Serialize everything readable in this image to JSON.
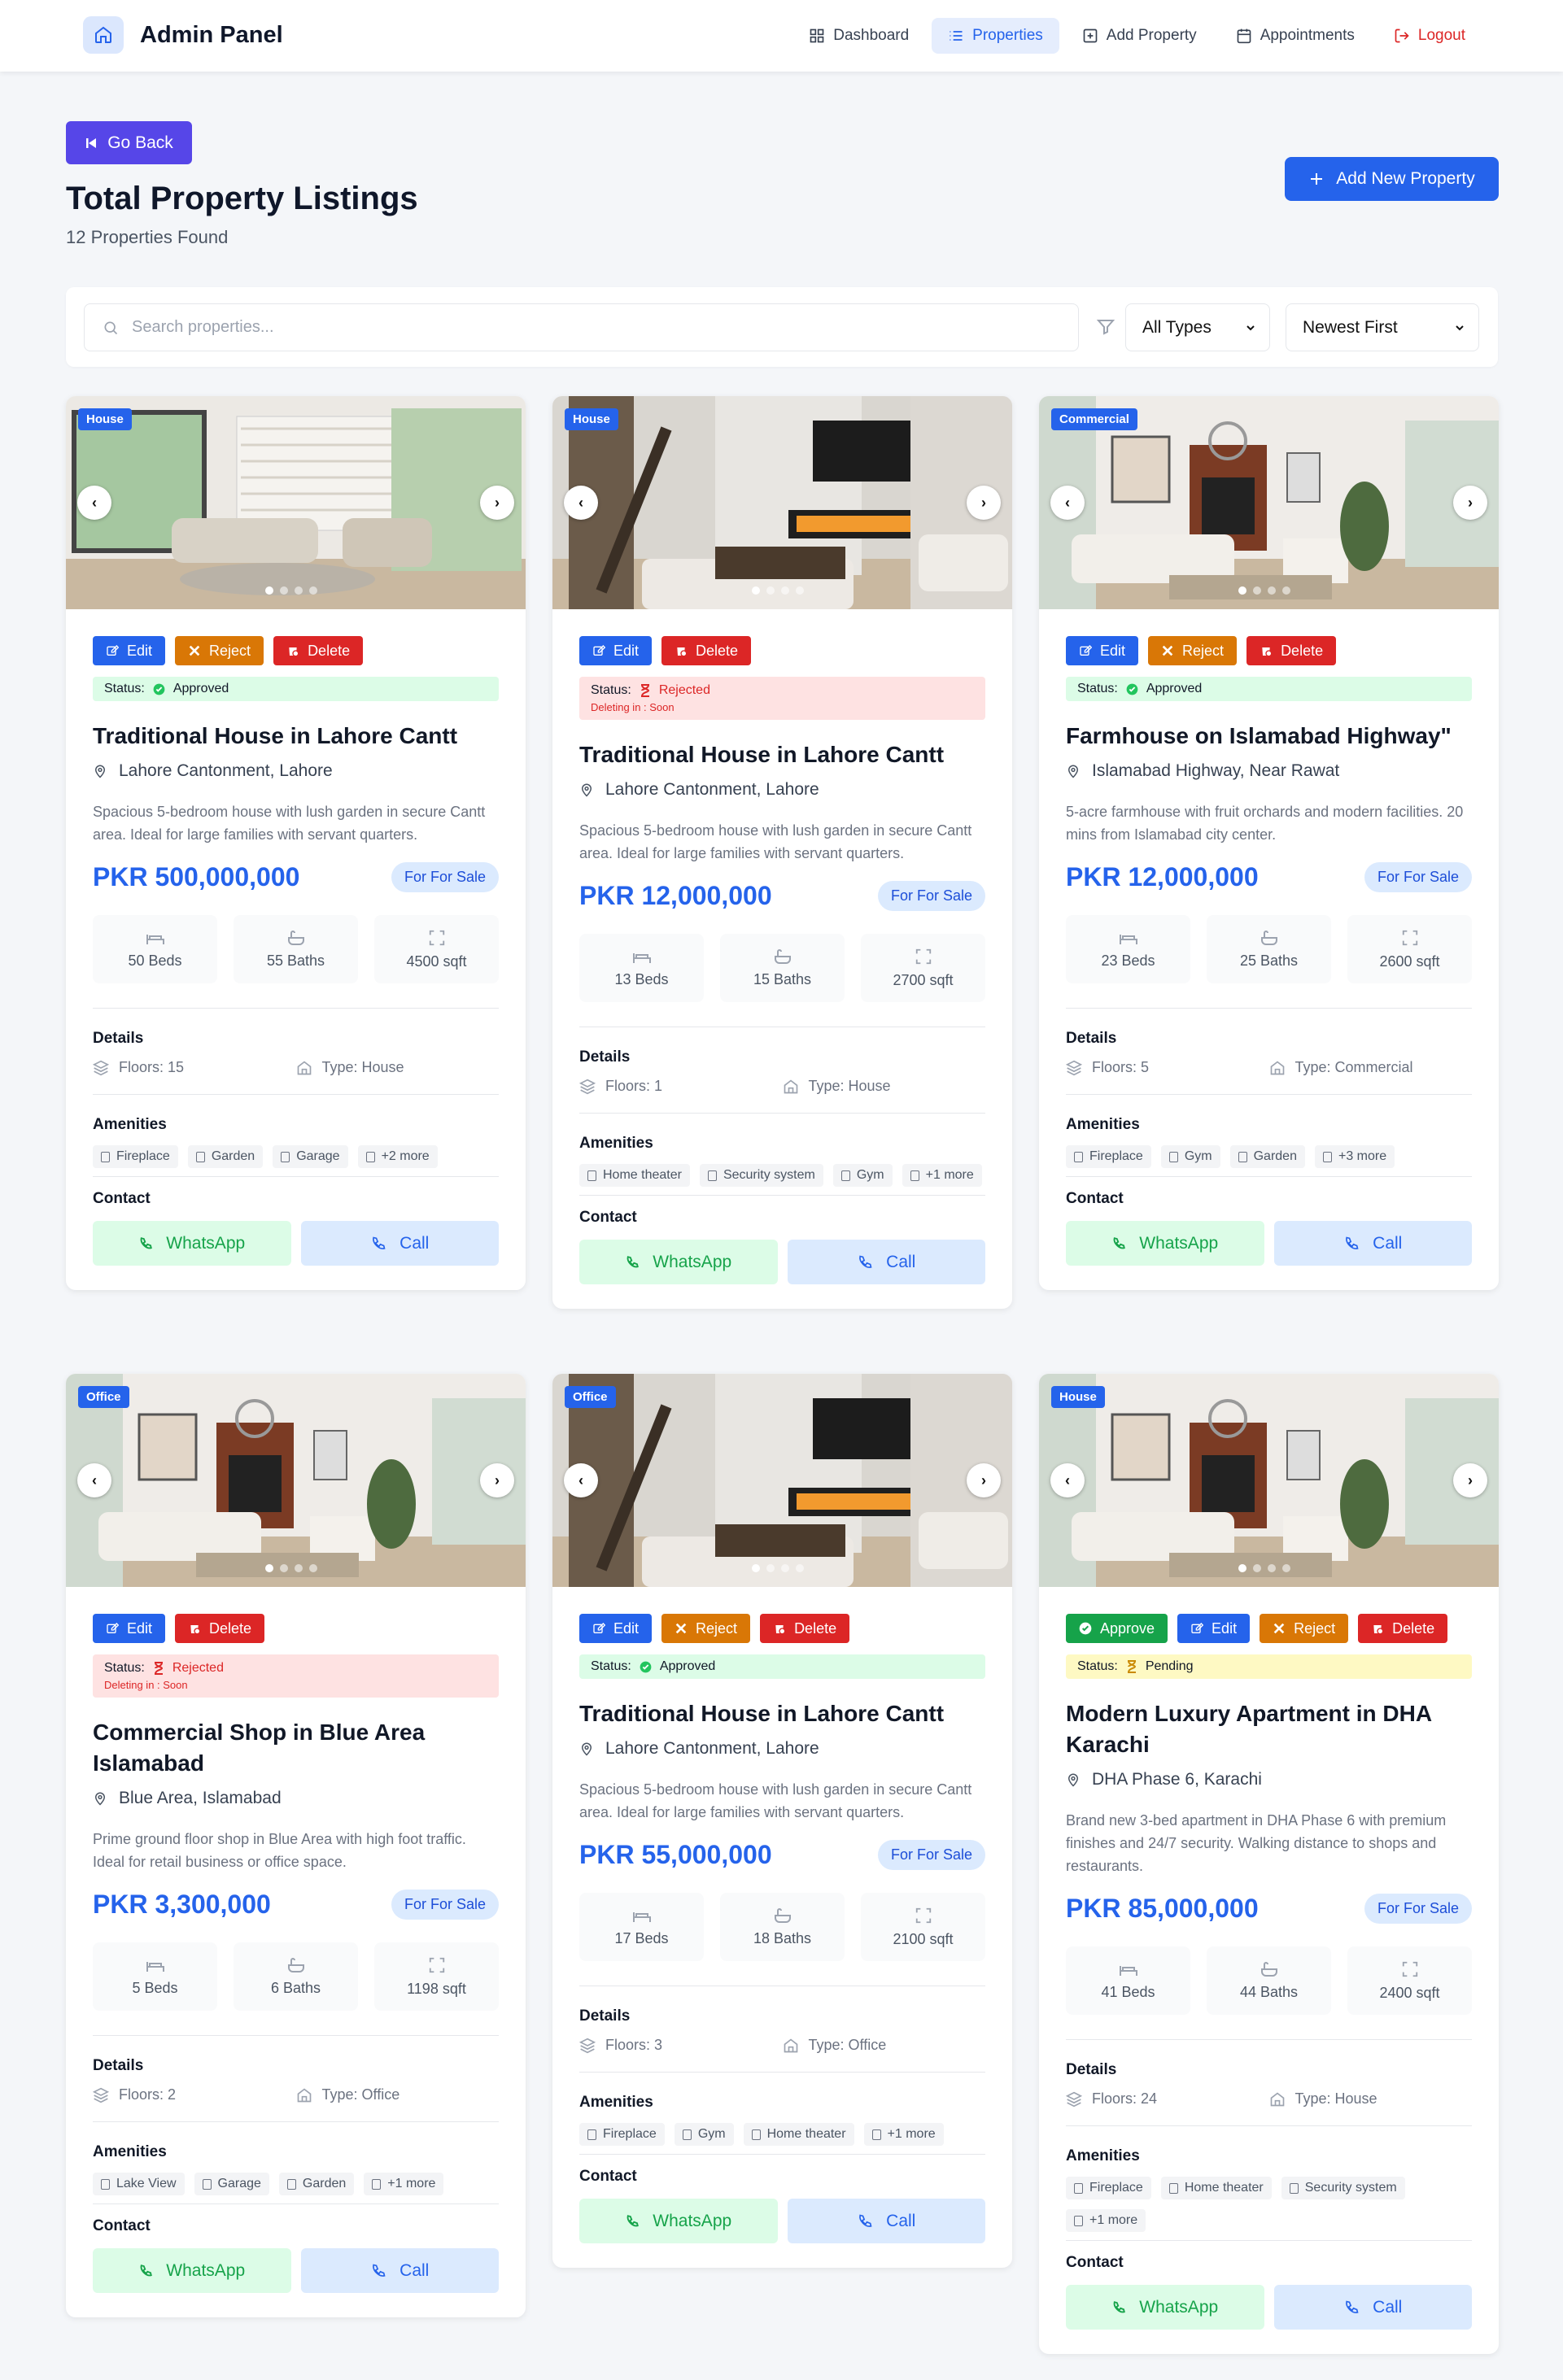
{
  "nav": {
    "brand": "Admin Panel",
    "items": [
      {
        "label": "Dashboard",
        "icon": "grid-icon"
      },
      {
        "label": "Properties",
        "icon": "list-icon"
      },
      {
        "label": "Add Property",
        "icon": "plus-square-icon"
      },
      {
        "label": "Appointments",
        "icon": "calendar-icon"
      }
    ],
    "logout": "Logout"
  },
  "header": {
    "go_back": "Go Back",
    "title": "Total Property Listings",
    "subtitle": "12 Properties Found",
    "add_button": "Add New Property"
  },
  "filters": {
    "search_placeholder": "Search properties...",
    "type_selected": "All Types",
    "sort_selected": "Newest First"
  },
  "labels": {
    "edit": "Edit",
    "reject": "Reject",
    "delete": "Delete",
    "approve": "Approve",
    "status": "Status:",
    "deleting": "Deleting in : Soon",
    "details": "Details",
    "amenities": "Amenities",
    "contact": "Contact",
    "whatsapp": "WhatsApp",
    "call": "Call"
  },
  "colors": {
    "primary": "#2563eb",
    "approved": "#16a34a",
    "rejected": "#dc2626",
    "pending": "#ca8a04",
    "go_back": "#5646e8"
  },
  "properties": [
    {
      "tag": "House",
      "image": "living-room-bright",
      "actions": [
        "edit",
        "reject",
        "delete"
      ],
      "status": "Approved",
      "title": "Traditional House in Lahore Cantt",
      "location": "Lahore Cantonment, Lahore",
      "description": "Spacious 5-bedroom house with lush garden in secure Cantt area. Ideal for large families with servant quarters.",
      "price": "PKR 500,000,000",
      "sale": "For For Sale",
      "beds": "50 Beds",
      "baths": "55 Baths",
      "area": "4500 sqft",
      "floors": "Floors: 15",
      "type": "Type: House",
      "amenities": [
        "Fireplace",
        "Garden",
        "Garage",
        "+2 more"
      ]
    },
    {
      "tag": "House",
      "image": "living-room-fireplace",
      "actions": [
        "edit",
        "delete"
      ],
      "status": "Rejected",
      "title": "Traditional House in Lahore Cantt",
      "location": "Lahore Cantonment, Lahore",
      "description": "Spacious 5-bedroom house with lush garden in secure Cantt area. Ideal for large families with servant quarters.",
      "price": "PKR 12,000,000",
      "sale": "For For Sale",
      "beds": "13 Beds",
      "baths": "15 Baths",
      "area": "2700 sqft",
      "floors": "Floors: 1",
      "type": "Type: House",
      "amenities": [
        "Home theater",
        "Security system",
        "Gym",
        "+1 more"
      ]
    },
    {
      "tag": "Commercial",
      "image": "living-room-brick",
      "actions": [
        "edit",
        "reject",
        "delete"
      ],
      "status": "Approved",
      "title": "Farmhouse on Islamabad Highway\"",
      "location": "Islamabad Highway, Near Rawat",
      "description": "5-acre farmhouse with fruit orchards and modern facilities. 20 mins from Islamabad city center.",
      "price": "PKR 12,000,000",
      "sale": "For For Sale",
      "beds": "23 Beds",
      "baths": "25 Baths",
      "area": "2600 sqft",
      "floors": "Floors: 5",
      "type": "Type: Commercial",
      "amenities": [
        "Fireplace",
        "Gym",
        "Garden",
        "+3 more"
      ]
    },
    {
      "tag": "Office",
      "image": "living-room-brick",
      "actions": [
        "edit",
        "delete"
      ],
      "status": "Rejected",
      "title": "Commercial Shop in Blue Area Islamabad",
      "location": "Blue Area, Islamabad",
      "description": "Prime ground floor shop in Blue Area with high foot traffic. Ideal for retail business or office space.",
      "price": "PKR 3,300,000",
      "sale": "For For Sale",
      "beds": "5 Beds",
      "baths": "6 Baths",
      "area": "1198 sqft",
      "floors": "Floors: 2",
      "type": "Type: Office",
      "amenities": [
        "Lake View",
        "Garage",
        "Garden",
        "+1 more"
      ]
    },
    {
      "tag": "Office",
      "image": "living-room-fireplace",
      "actions": [
        "edit",
        "reject",
        "delete"
      ],
      "status": "Approved",
      "title": "Traditional House in Lahore Cantt",
      "location": "Lahore Cantonment, Lahore",
      "description": "Spacious 5-bedroom house with lush garden in secure Cantt area. Ideal for large families with servant quarters.",
      "price": "PKR 55,000,000",
      "sale": "For For Sale",
      "beds": "17 Beds",
      "baths": "18 Baths",
      "area": "2100 sqft",
      "floors": "Floors: 3",
      "type": "Type: Office",
      "amenities": [
        "Fireplace",
        "Gym",
        "Home theater",
        "+1 more"
      ]
    },
    {
      "tag": "House",
      "image": "living-room-brick",
      "actions": [
        "approve",
        "edit",
        "reject",
        "delete"
      ],
      "status": "Pending",
      "title": "Modern Luxury Apartment in DHA Karachi",
      "location": "DHA Phase 6, Karachi",
      "description": "Brand new 3-bed apartment in DHA Phase 6 with premium finishes and 24/7 security. Walking distance to shops and restaurants.",
      "price": "PKR 85,000,000",
      "sale": "For For Sale",
      "beds": "41 Beds",
      "baths": "44 Baths",
      "area": "2400 sqft",
      "floors": "Floors: 24",
      "type": "Type: House",
      "amenities": [
        "Fireplace",
        "Home theater",
        "Security system",
        "+1 more"
      ]
    }
  ]
}
